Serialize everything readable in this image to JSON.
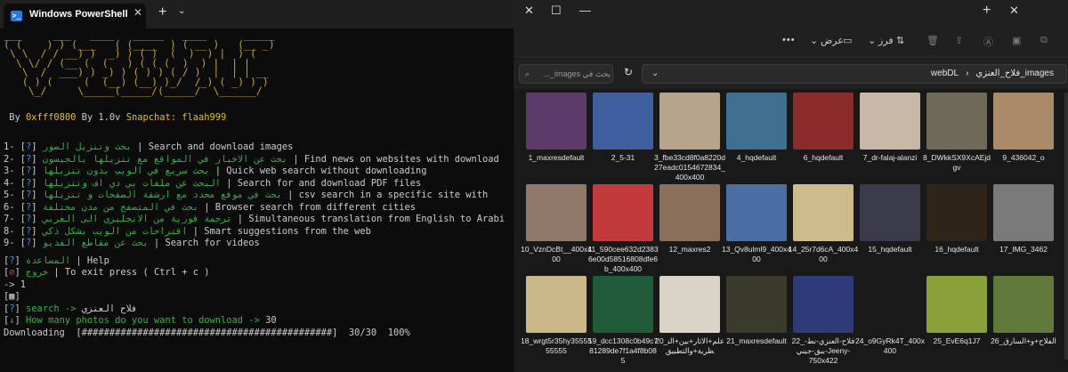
{
  "terminal": {
    "tab_title": "Windows PowerShell",
    "tab_close": "✕",
    "new_tab": "+",
    "dropdown": "⌄",
    "banner": [
      "___     ___   ____   _____   ____      _____",
      "( (    ) ) (___   ( (____  ) ( __ )   (__ _)",
      " \\ \\  / / __) )  _) ) ( )  (  )  ) |  ) (",
      "  \\ \\/ / (__ (  (   ) ( ( (  )  ) |  | |",
      "   \\  /  ___) ) _) ) ( ) ) ( / )  |  | | __",
      "   ( ) (     (  (__) (__) )_/  /_) ( _) ) )",
      "    \\_/     \\_____(_____/(_____/  \\______/"
    ],
    "by_prefix": "By",
    "by_name": "0xfff0800",
    "by_version": "By 1.0v",
    "snapchat": "Snapchat: flaah999",
    "menu": [
      {
        "num": "1-",
        "ar": "بحث وتنزيل الصور",
        "en": "Search and download images"
      },
      {
        "num": "2-",
        "ar": "بحث عن الاخبار في المواقع مع تنزيلها بالجيسون",
        "en": "Find news on websites with download"
      },
      {
        "num": "3-",
        "ar": "بحث سريع في الويب بدون تنزيلها",
        "en": "Quick web search without downloading"
      },
      {
        "num": "4-",
        "ar": "البحث عن ملفات بي دي اف وتنزيلها",
        "en": "Search for and download PDF files"
      },
      {
        "num": "5-",
        "ar": "بحث في موقع محدد مع ارشفة الصفحات و تنزيلها",
        "en": "csv search in a specific site with"
      },
      {
        "num": "6-",
        "ar": "بحث في المتصفح من مدن مختلفة",
        "en": "Browser search from different cities"
      },
      {
        "num": "7-",
        "ar": "ترجمة فورية من الانجليزي الى العربي",
        "en": "Simultaneous translation from English to Arabi"
      },
      {
        "num": "8-",
        "ar": "اقتراحات من الويب بشكل ذكي",
        "en": "Smart suggestions from the web"
      },
      {
        "num": "9-",
        "ar": "بحث عن مقاطع الفديو",
        "en": "Search for videos"
      }
    ],
    "help_ar": "المساعدة",
    "help_en": "Help",
    "exit_ar": "خروج",
    "exit_en": "To exit press ( Ctrl + c )",
    "prompt_input": "-> 1",
    "search_label": "search ->",
    "search_value": "فلاح العنزي",
    "photos_q": "How many photos do you want to download ->",
    "photos_value": "30",
    "progress_label": "Downloading",
    "progress_bar": "[#############################################]",
    "progress_count": "30/30",
    "progress_pct": "100%",
    "progress_fraction": 1.0
  },
  "explorer": {
    "win": {
      "minimize": "—",
      "maximize": "☐",
      "close": "✕",
      "new_tab": "+",
      "tab_close": "✕"
    },
    "toolbar": {
      "more": "•••",
      "view": "عرض",
      "sort": "فرز"
    },
    "search_placeholder": "بحث في images_...",
    "breadcrumb": [
      "webDL",
      "›",
      "فلاح_العنزي_images"
    ],
    "items": [
      {
        "name": "9_436042_o",
        "color": "#a98b6a"
      },
      {
        "name": "8_DWkkSX9XcAEjdgv",
        "color": "#6f6a58"
      },
      {
        "name": "7_dr-falaj-alanzi",
        "color": "#c8b7a6"
      },
      {
        "name": "6_hqdefault",
        "color": "#8a2c2c"
      },
      {
        "name": "4_hqdefault",
        "color": "#3f6f8f"
      },
      {
        "name": "3_fbe33cd8f0a8220d27eadc0154672834_400x400",
        "color": "#b7a48c"
      },
      {
        "name": "2_5-31",
        "color": "#3f5f9f"
      },
      {
        "name": "1_maxresdefault",
        "color": "#5a3b6a"
      },
      {
        "name": "17_IMG_3462",
        "color": "#7a7a7a"
      },
      {
        "name": "16_hqdefault",
        "color": "#2e2418"
      },
      {
        "name": "15_hqdefault",
        "color": "#3a3a4a"
      },
      {
        "name": "14_25r7d6cA_400x400",
        "color": "#cdb98a"
      },
      {
        "name": "13_Qv8ulml9_400x400",
        "color": "#4b6fa5"
      },
      {
        "name": "12_maxres2",
        "color": "#8a6f5a"
      },
      {
        "name": "11_590cee632d23836e00d58516808dfe6b_400x400",
        "color": "#c23a3a"
      },
      {
        "name": "10_VznDcBt__400x400",
        "color": "#8f7a6a"
      },
      {
        "name": "26_الفلاح+و+السارق",
        "color": "#5f7a3a"
      },
      {
        "name": "25_EvE6q1J7",
        "color": "#8aa03a"
      },
      {
        "name": "24_o9GyRk4T_400x400",
        "color": "#1a1a1a"
      },
      {
        "name": "22_فلاح-العنزي-نط-ببق-جيني-Jeeny-750x422",
        "color": "#2f3a7a"
      },
      {
        "name": "21_maxresdefault",
        "color": "#3b3b2b"
      },
      {
        "name": "20_علم+الاثار+بين+النظرية+والتطبيق",
        "color": "#d9d4c6"
      },
      {
        "name": "19_dcc1308c0b49c781289de7f1a4f8b085",
        "color": "#1f5a3a"
      },
      {
        "name": "18_wrgt5r35hy3555555555",
        "color": "#c9b98a"
      }
    ]
  }
}
